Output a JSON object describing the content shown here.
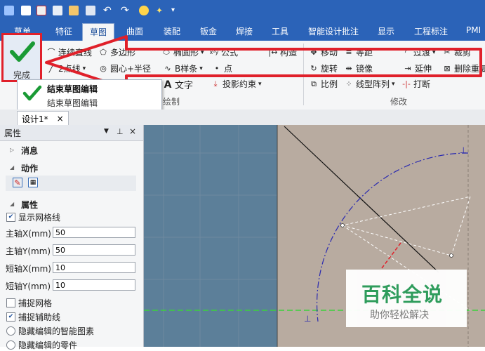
{
  "tabs": [
    {
      "label": "草单"
    },
    {
      "label": "特征"
    },
    {
      "label": "草图",
      "active": true
    },
    {
      "label": "曲面"
    },
    {
      "label": "装配"
    },
    {
      "label": "钣金"
    },
    {
      "label": "焊接"
    },
    {
      "label": "工具"
    },
    {
      "label": "智能设计批注"
    },
    {
      "label": "显示"
    },
    {
      "label": "工程标注"
    },
    {
      "label": "PMI"
    }
  ],
  "ribbon": {
    "finish_label": "完成",
    "draw": {
      "polyline": "连续直线",
      "polygon": "多边形",
      "ellipse": "椭圆形",
      "formula": "公式",
      "construct": "构造",
      "two_point_line": "2点线",
      "circle": "圆心+半径",
      "bspline": "B样条",
      "point": "点",
      "text": "文字",
      "projection_constraint": "投影约束",
      "group_label": "绘制"
    },
    "modify": {
      "move": "移动",
      "equidistant": "等距",
      "transition": "过渡",
      "trim": "裁剪",
      "rotate": "旋转",
      "mirror": "镜像",
      "extend": "延伸",
      "delete_overlap": "删除重复",
      "scale": "比例",
      "linear_array": "线型阵列",
      "break": "打断",
      "group_label": "修改"
    }
  },
  "popup": {
    "title": "结束草图编辑",
    "description": "结束草图编辑"
  },
  "document_tab": {
    "label": "设计1*",
    "close": "×"
  },
  "panel": {
    "title": "属性",
    "sections": {
      "messages": "消息",
      "actions": "动作",
      "properties": "属性"
    },
    "show_grid": {
      "label": "显示网格线",
      "checked": true
    },
    "fields": [
      {
        "label": "主轴X(mm)",
        "value": "50"
      },
      {
        "label": "主轴Y(mm)",
        "value": "50"
      },
      {
        "label": "短轴X(mm)",
        "value": "10"
      },
      {
        "label": "短轴Y(mm)",
        "value": "10"
      }
    ],
    "snap_grid": {
      "label": "捕捉网格",
      "checked": false
    },
    "snap_guides": {
      "label": "捕捉辅助线",
      "checked": true
    },
    "hide_smart": {
      "label": "隐藏编辑的智能图素"
    },
    "hide_parts": {
      "label": "隐藏编辑的零件"
    }
  },
  "watermark": {
    "title": "百科全说",
    "subtitle": "助你轻松解决"
  },
  "colors": {
    "titlebar": "#2b63b8",
    "ribbon_bg": "#f5f6f7",
    "highlight_red": "#e0202a",
    "check_green": "#1a9a35",
    "canvas_blue": "#5c7f99",
    "canvas_beige": "#b8aba0",
    "watermark_green": "#2a9c5a"
  }
}
